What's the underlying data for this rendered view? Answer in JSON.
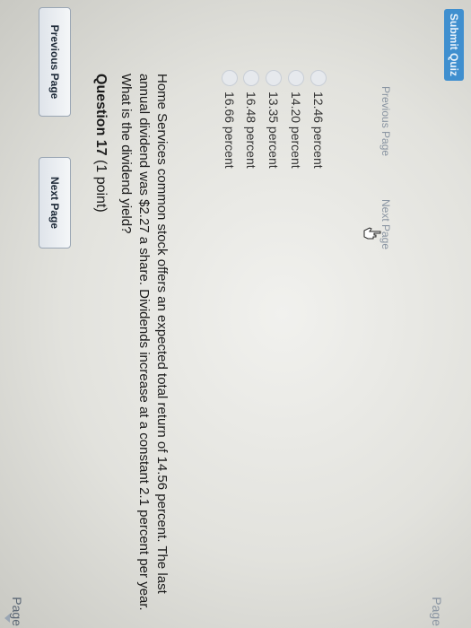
{
  "page_nav": {
    "page_label_top": "Page",
    "page_label_bottom": "Page"
  },
  "top_buttons": {
    "previous_label": "Previous Page",
    "next_label": "Next Page"
  },
  "question": {
    "title": "Question 17",
    "points": "(1 point)",
    "text": "Home Services common stock offers an expected total return of 14.56 percent. The last annual dividend was $2.27 a share. Dividends increase at a constant 2.1 percent per year. What is the dividend yield?"
  },
  "answers": [
    {
      "label": "16.66 percent"
    },
    {
      "label": "16.48 percent"
    },
    {
      "label": "13.35 percent"
    },
    {
      "label": "14.20 percent"
    },
    {
      "label": "12.46 percent"
    }
  ],
  "bottom_nav": {
    "previous_label": "Previous Page",
    "next_label": "Next Page"
  },
  "submit": {
    "label": "Submit Quiz"
  }
}
